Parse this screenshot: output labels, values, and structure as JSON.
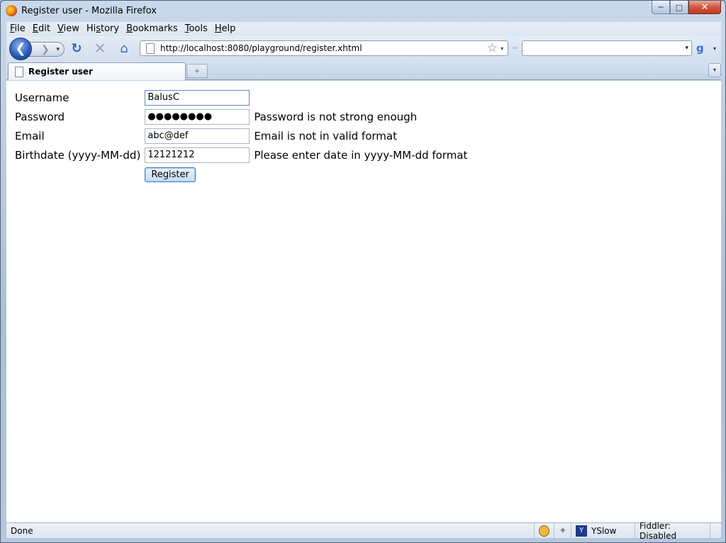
{
  "window": {
    "title": "Register user - Mozilla Firefox",
    "minimize": "─",
    "maximize": "□",
    "close": "✕"
  },
  "menu": [
    {
      "pre": "",
      "u": "F",
      "post": "ile"
    },
    {
      "pre": "",
      "u": "E",
      "post": "dit"
    },
    {
      "pre": "",
      "u": "V",
      "post": "iew"
    },
    {
      "pre": "Hi",
      "u": "s",
      "post": "tory"
    },
    {
      "pre": "",
      "u": "B",
      "post": "ookmarks"
    },
    {
      "pre": "",
      "u": "T",
      "post": "ools"
    },
    {
      "pre": "",
      "u": "H",
      "post": "elp"
    }
  ],
  "nav": {
    "back_glyph": "❮",
    "forward_glyph": "❯",
    "reload_glyph": "↻",
    "stop_glyph": "✕",
    "home_glyph": "⌂",
    "url": "http://localhost:8080/playground/register.xhtml",
    "bookmark_star": "☆",
    "dropdown": "▾",
    "search_value": "",
    "search_engine_glyph": "g"
  },
  "tabs": {
    "active_label": "Register user",
    "new_tab": "+",
    "list_all": "▾"
  },
  "form": {
    "username_label": "Username",
    "username_value": "BalusC",
    "password_label": "Password",
    "password_value": "●●●●●●●●",
    "password_message": "Password is not strong enough",
    "email_label": "Email",
    "email_value": "abc@def",
    "email_message": "Email is not in valid format",
    "birthdate_label": "Birthdate (yyyy-MM-dd)",
    "birthdate_value": "12121212",
    "birthdate_message": "Please enter date in yyyy-MM-dd format",
    "submit_label": "Register"
  },
  "status": {
    "text": "Done",
    "yslow_label": "YSlow",
    "yslow_glyph": "Y",
    "fiddler_label": "Fiddler: Disabled"
  },
  "colors": {
    "frame": "#a9c0d9",
    "close_button": "#d2563f",
    "back_button": "#2856b3"
  }
}
